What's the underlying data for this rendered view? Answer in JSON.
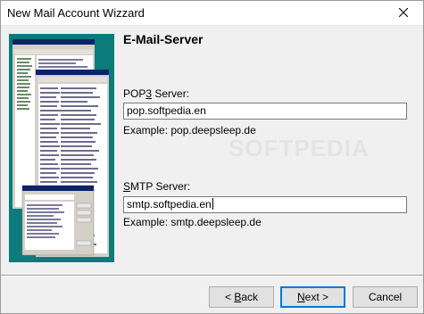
{
  "window": {
    "title": "New Mail Account Wizzard"
  },
  "page": {
    "heading": "E-Mail-Server",
    "pop3": {
      "label_prefix": "POP",
      "label_accel": "3",
      "label_suffix": " Server:",
      "value": "pop.softpedia.en",
      "example": "Example: pop.deepsleep.de"
    },
    "smtp": {
      "label_prefix": "",
      "label_accel": "S",
      "label_suffix": "MTP Server:",
      "value": "smtp.softpedia.en",
      "example": "Example: smtp.deepsleep.de"
    },
    "watermark": "SOFTPEDIA"
  },
  "buttons": {
    "back": {
      "prefix": "< ",
      "accel": "B",
      "suffix": "ack"
    },
    "next": {
      "prefix": "",
      "accel": "N",
      "suffix": "ext >"
    },
    "cancel": "Cancel"
  },
  "colors": {
    "side_panel": "#0b7b7b",
    "default_button_border": "#0078d7"
  },
  "icons": {
    "close": "close-icon"
  }
}
